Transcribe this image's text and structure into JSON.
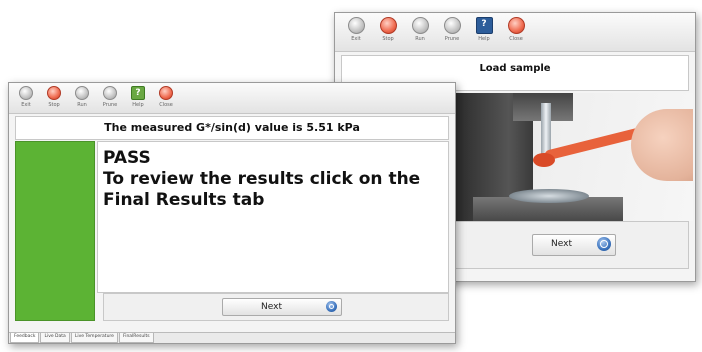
{
  "back_window": {
    "toolbar": [
      {
        "label": "Exit",
        "icon": "grey-circle-icon",
        "color": "grey"
      },
      {
        "label": "Stop",
        "icon": "stop-icon",
        "color": "red"
      },
      {
        "label": "Run",
        "icon": "run-icon",
        "color": "grey"
      },
      {
        "label": "Prune",
        "icon": "prune-icon",
        "color": "grey"
      },
      {
        "label": "Help",
        "icon": "help-icon",
        "color": "blue"
      },
      {
        "label": "Close",
        "icon": "close-icon",
        "color": "red"
      }
    ],
    "message": "Load sample",
    "next_label": "Next"
  },
  "front_window": {
    "toolbar": [
      {
        "label": "Exit",
        "icon": "grey-circle-icon",
        "color": "grey"
      },
      {
        "label": "Stop",
        "icon": "stop-icon",
        "color": "red"
      },
      {
        "label": "Run",
        "icon": "run-icon",
        "color": "grey"
      },
      {
        "label": "Prune",
        "icon": "prune-icon",
        "color": "grey"
      },
      {
        "label": "Help",
        "icon": "help-icon",
        "color": "green"
      },
      {
        "label": "Close",
        "icon": "close-icon",
        "color": "red"
      }
    ],
    "message": "The measured G*/sin(d) value is 5.51 kPa",
    "result_status": "PASS",
    "result_message": "To review the results click on the Final Results tab",
    "next_label": "Next",
    "status_color": "#5cb334",
    "tabs": [
      "Feedback",
      "Live Data",
      "Live Temperature",
      "FinalResults"
    ]
  },
  "colors": {
    "pass_green": "#5cb334",
    "stop_red": "#ef6a4f",
    "help_blue": "#2d5d9a",
    "spatula_orange": "#e8623b"
  }
}
